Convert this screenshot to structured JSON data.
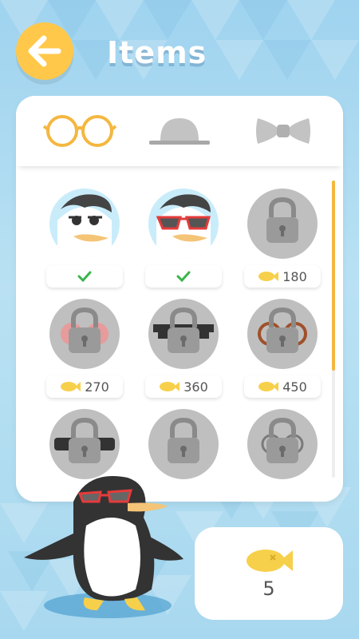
{
  "header": {
    "title": "Items"
  },
  "tabs": [
    {
      "name": "glasses",
      "icon": "glasses-icon",
      "active": true
    },
    {
      "name": "hat",
      "icon": "hat-icon",
      "active": false
    },
    {
      "name": "bowtie",
      "icon": "bowtie-icon",
      "active": false
    }
  ],
  "items": [
    {
      "state": "owned",
      "label": ""
    },
    {
      "state": "owned",
      "label": ""
    },
    {
      "state": "locked",
      "price": "180"
    },
    {
      "state": "locked",
      "price": "270"
    },
    {
      "state": "locked",
      "price": "360"
    },
    {
      "state": "locked",
      "price": "450"
    },
    {
      "state": "locked",
      "price": ""
    },
    {
      "state": "locked",
      "price": ""
    },
    {
      "state": "locked",
      "price": ""
    }
  ],
  "wallet": {
    "coins": "5"
  },
  "colors": {
    "accent": "#f4b740",
    "check": "#3ab54a",
    "back": "#ffc84a"
  }
}
